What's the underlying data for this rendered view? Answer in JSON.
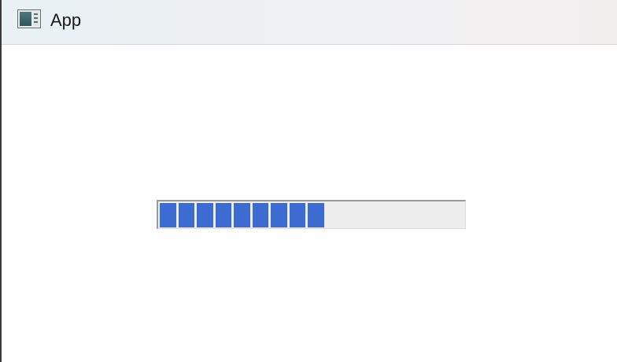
{
  "window": {
    "title": "App",
    "icon": "app-window-icon"
  },
  "progress": {
    "value_fraction": 0.54,
    "filled_blocks": 9,
    "bar_color": "#3c6bd1",
    "track_color": "#ededed"
  }
}
